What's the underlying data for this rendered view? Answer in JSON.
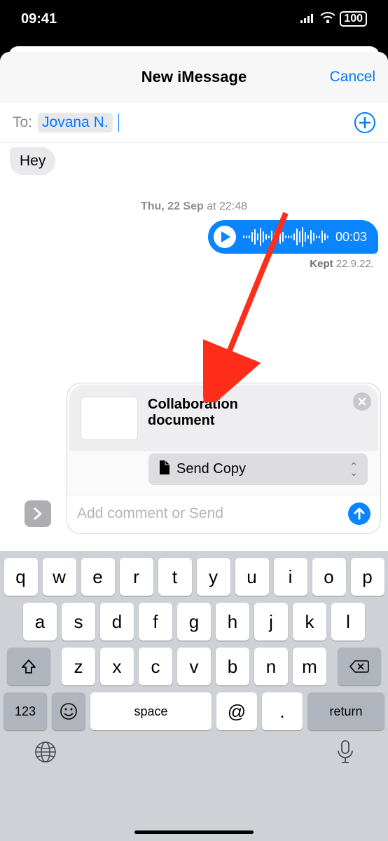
{
  "status_bar": {
    "time": "09:41",
    "battery": "100"
  },
  "header": {
    "title": "New iMessage",
    "cancel": "Cancel"
  },
  "to_field": {
    "label": "To:",
    "recipient": "Jovana N."
  },
  "conversation": {
    "incoming_text": "Hey",
    "timestamp_bold": "Thu, 22 Sep",
    "timestamp_rest": " at 22:48",
    "audio_duration": "00:03",
    "kept_label": "Kept",
    "kept_date": "22.9.22."
  },
  "attachment": {
    "title_line1": "Collaboration",
    "title_line2": "document",
    "send_copy": "Send Copy",
    "input_placeholder": "Add comment or Send"
  },
  "keyboard": {
    "row1": [
      "q",
      "w",
      "e",
      "r",
      "t",
      "y",
      "u",
      "i",
      "o",
      "p"
    ],
    "row2": [
      "a",
      "s",
      "d",
      "f",
      "g",
      "h",
      "j",
      "k",
      "l"
    ],
    "row3": [
      "z",
      "x",
      "c",
      "v",
      "b",
      "n",
      "m"
    ],
    "k123": "123",
    "space": "space",
    "at": "@",
    "dot": ".",
    "return": "return"
  }
}
